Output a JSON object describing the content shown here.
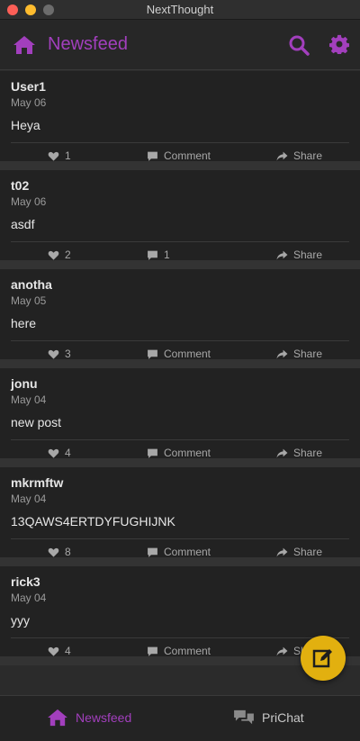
{
  "window": {
    "title": "NextThought"
  },
  "header": {
    "title": "Newsfeed"
  },
  "colors": {
    "accent": "#a23fbd",
    "fab": "#e2b00f",
    "background": "#222222"
  },
  "posts": [
    {
      "user": "User1",
      "date": "May 06",
      "content": "Heya",
      "likes": "1",
      "comment_label": "Comment",
      "share_label": "Share"
    },
    {
      "user": "t02",
      "date": "May 06",
      "content": "asdf",
      "likes": "2",
      "comment_label": "1",
      "share_label": "Share"
    },
    {
      "user": "anotha",
      "date": "May 05",
      "content": "here",
      "likes": "3",
      "comment_label": "Comment",
      "share_label": "Share"
    },
    {
      "user": "jonu",
      "date": "May 04",
      "content": "new post",
      "likes": "4",
      "comment_label": "Comment",
      "share_label": "Share"
    },
    {
      "user": "mkrmftw",
      "date": "May 04",
      "content": "13QAWS4ERTDYFUGHIJNK",
      "likes": "8",
      "comment_label": "Comment",
      "share_label": "Share"
    },
    {
      "user": "rick3",
      "date": "May 04",
      "content": "yyy",
      "likes": "4",
      "comment_label": "Comment",
      "share_label": "Share"
    }
  ],
  "icons": {
    "home": "home-icon",
    "search": "search-icon",
    "settings": "gear-icon",
    "like": "heart-icon",
    "comment": "comment-icon",
    "share": "share-icon",
    "compose": "edit-icon",
    "chat": "chat-icon"
  },
  "bottom_nav": {
    "newsfeed_label": "Newsfeed",
    "prichat_label": "PriChat"
  }
}
